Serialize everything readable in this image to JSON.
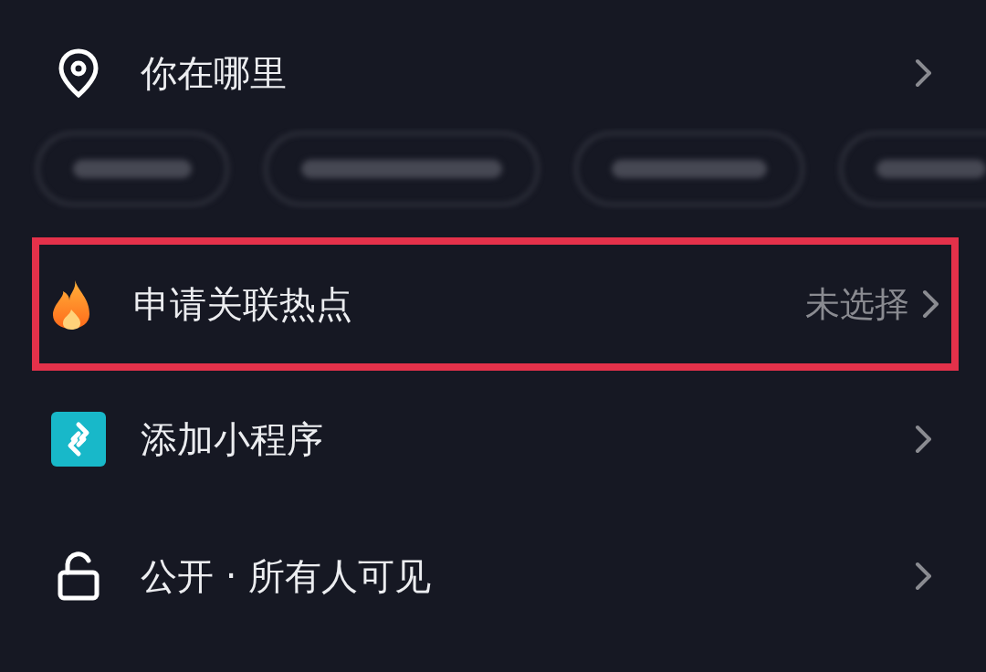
{
  "rows": [
    {
      "kind": "location",
      "label": "你在哪里",
      "highlighted": false
    },
    {
      "kind": "hotspot",
      "label": "申请关联热点",
      "value": "未选择",
      "highlighted": true
    },
    {
      "kind": "miniprogram",
      "label": "添加小程序",
      "highlighted": false
    },
    {
      "kind": "visibility",
      "label": "公开 · 所有人可见",
      "highlighted": false
    }
  ],
  "suggestions": [
    {
      "blurred": true
    },
    {
      "blurred": true
    },
    {
      "blurred": true
    },
    {
      "blurred": true
    }
  ]
}
